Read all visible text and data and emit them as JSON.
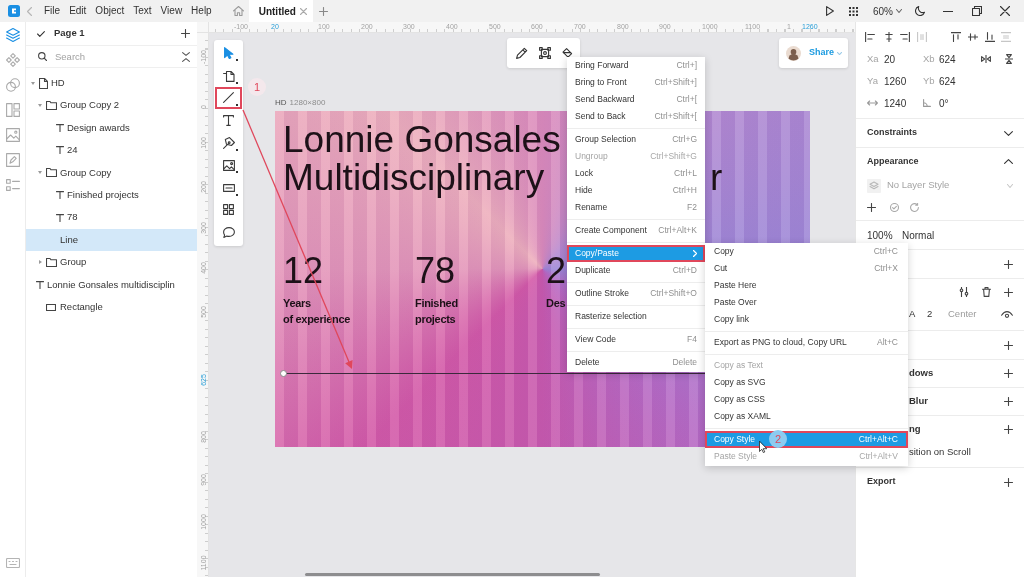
{
  "title_bar": {
    "menus": [
      {
        "label": "File"
      },
      {
        "label": "Edit"
      },
      {
        "label": "Object"
      },
      {
        "label": "Text"
      },
      {
        "label": "View"
      },
      {
        "label": "Help"
      }
    ],
    "tabs": [
      {
        "label": "Untitled",
        "selected": true
      }
    ],
    "zoom": "60%"
  },
  "sidebar_tabs": [
    {
      "selected": true
    },
    {
      "selected": false
    },
    {
      "selected": false
    },
    {
      "selected": false
    },
    {
      "selected": false
    },
    {
      "selected": false
    },
    {
      "selected": false
    }
  ],
  "layers_panel": {
    "page": "Page 1",
    "search": {
      "placeholder": "Search"
    },
    "tree": [
      {
        "label": "HD",
        "kind": "artboard",
        "expanded": true,
        "selected": false,
        "children": [
          {
            "label": "Group Copy 2",
            "kind": "group",
            "expanded": true,
            "selected": false,
            "children": [
              {
                "label": "Design awards",
                "kind": "text",
                "selected": false
              },
              {
                "label": "24",
                "kind": "text",
                "selected": false
              }
            ]
          },
          {
            "label": "Group Copy",
            "kind": "group",
            "expanded": true,
            "selected": false,
            "children": [
              {
                "label": "Finished projects",
                "kind": "text",
                "selected": false
              },
              {
                "label": "78",
                "kind": "text",
                "selected": false
              },
              {
                "label": "Line",
                "kind": "line",
                "selected": true
              }
            ]
          },
          {
            "label": "Group",
            "kind": "group",
            "expanded": false,
            "selected": false
          },
          {
            "label": "Lonnie Gonsales multidisciplin",
            "kind": "text",
            "selected": false
          },
          {
            "label": "Rectangle",
            "kind": "rectangle",
            "selected": false
          }
        ]
      }
    ]
  },
  "rulers": {
    "horizontal": [
      {
        "label": "-100",
        "highlighted": false
      },
      {
        "label": "20",
        "highlighted": true
      },
      {
        "label": "100",
        "highlighted": false
      },
      {
        "label": "200",
        "highlighted": false
      },
      {
        "label": "300",
        "highlighted": false
      },
      {
        "label": "400",
        "highlighted": false
      },
      {
        "label": "500",
        "highlighted": false
      },
      {
        "label": "600",
        "highlighted": false
      },
      {
        "label": "700",
        "highlighted": false
      },
      {
        "label": "800",
        "highlighted": false
      },
      {
        "label": "900",
        "highlighted": false
      },
      {
        "label": "1000",
        "highlighted": false
      },
      {
        "label": "1100",
        "highlighted": false
      },
      {
        "label": "1",
        "highlighted": false
      },
      {
        "label": "1260",
        "highlighted": true
      }
    ],
    "vertical": [
      {
        "label": "-100",
        "highlighted": false
      },
      {
        "label": "0",
        "highlighted": false
      },
      {
        "label": "100",
        "highlighted": false
      },
      {
        "label": "200",
        "highlighted": false
      },
      {
        "label": "300",
        "highlighted": false
      },
      {
        "label": "400",
        "highlighted": false
      },
      {
        "label": "500",
        "highlighted": false
      },
      {
        "label": "625",
        "highlighted": true
      },
      {
        "label": "800",
        "highlighted": false
      },
      {
        "label": "900",
        "highlighted": false
      },
      {
        "label": "1000",
        "highlighted": false
      },
      {
        "label": "1100",
        "highlighted": false
      }
    ]
  },
  "tools": [
    {
      "selected": true,
      "outlined": false,
      "has_options": true
    },
    {
      "selected": false,
      "outlined": false,
      "has_options": true
    },
    {
      "selected": false,
      "outlined": true,
      "has_options": true
    },
    {
      "selected": false,
      "outlined": false,
      "has_options": false
    },
    {
      "selected": false,
      "outlined": false,
      "has_options": true
    },
    {
      "selected": false,
      "outlined": false,
      "has_options": true
    },
    {
      "selected": false,
      "outlined": false,
      "has_options": true
    },
    {
      "selected": false,
      "outlined": false,
      "has_options": false
    },
    {
      "selected": false,
      "outlined": false,
      "has_options": false
    }
  ],
  "share": {
    "label": "Share"
  },
  "artboard": {
    "name": "HD",
    "size": "1280×800",
    "heading_lines": [
      "Lonnie Gonsales",
      "Multidisciplinary"
    ],
    "heading_fragment": "r",
    "stats": [
      {
        "value": "12",
        "label_lines": [
          "Years",
          "of experience"
        ]
      },
      {
        "value": "78",
        "label_lines": [
          "Finished",
          "projects"
        ]
      },
      {
        "value": "2",
        "label_lines": [
          "Des"
        ]
      }
    ]
  },
  "context_menu": {
    "sections": [
      {
        "items": [
          {
            "label": "Bring Forward",
            "shortcut": "Ctrl+]",
            "disabled": false,
            "selected": false,
            "outlined": false,
            "submenu": false
          },
          {
            "label": "Bring to Front",
            "shortcut": "Ctrl+Shift+]",
            "disabled": false,
            "selected": false,
            "outlined": false,
            "submenu": false
          },
          {
            "label": "Send Backward",
            "shortcut": "Ctrl+[",
            "disabled": false,
            "selected": false,
            "outlined": false,
            "submenu": false
          },
          {
            "label": "Send to Back",
            "shortcut": "Ctrl+Shift+[",
            "disabled": false,
            "selected": false,
            "outlined": false,
            "submenu": false
          }
        ]
      },
      {
        "items": [
          {
            "label": "Group Selection",
            "shortcut": "Ctrl+G",
            "disabled": false,
            "selected": false,
            "outlined": false,
            "submenu": false
          },
          {
            "label": "Ungroup",
            "shortcut": "Ctrl+Shift+G",
            "disabled": true,
            "selected": false,
            "outlined": false,
            "submenu": false
          },
          {
            "label": "Lock",
            "shortcut": "Ctrl+L",
            "disabled": false,
            "selected": false,
            "outlined": false,
            "submenu": false
          },
          {
            "label": "Hide",
            "shortcut": "Ctrl+H",
            "disabled": false,
            "selected": false,
            "outlined": false,
            "submenu": false
          },
          {
            "label": "Rename",
            "shortcut": "F2",
            "disabled": false,
            "selected": false,
            "outlined": false,
            "submenu": false
          }
        ]
      },
      {
        "items": [
          {
            "label": "Create Component",
            "shortcut": "Ctrl+Alt+K",
            "disabled": false,
            "selected": false,
            "outlined": false,
            "submenu": false
          }
        ]
      },
      {
        "items": [
          {
            "label": "Copy/Paste",
            "disabled": false,
            "selected": true,
            "outlined": true,
            "submenu": true
          },
          {
            "label": "Duplicate",
            "shortcut": "Ctrl+D",
            "disabled": false,
            "selected": false,
            "outlined": false,
            "submenu": false
          }
        ]
      },
      {
        "items": [
          {
            "label": "Outline Stroke",
            "shortcut": "Ctrl+Shift+O",
            "disabled": false,
            "selected": false,
            "outlined": false,
            "submenu": false
          }
        ]
      },
      {
        "items": [
          {
            "label": "Rasterize selection",
            "disabled": false,
            "selected": false,
            "outlined": false,
            "submenu": false
          }
        ]
      },
      {
        "items": [
          {
            "label": "View Code",
            "shortcut": "F4",
            "disabled": false,
            "selected": false,
            "outlined": false,
            "submenu": false
          }
        ]
      },
      {
        "items": [
          {
            "label": "Delete",
            "shortcut": "Delete",
            "disabled": false,
            "selected": false,
            "outlined": false,
            "submenu": false
          }
        ]
      }
    ]
  },
  "submenu": {
    "sections": [
      {
        "items": [
          {
            "label": "Copy",
            "shortcut": "Ctrl+C",
            "disabled": false,
            "selected": false,
            "outlined": false,
            "submenu": false
          },
          {
            "label": "Cut",
            "shortcut": "Ctrl+X",
            "disabled": false,
            "selected": false,
            "outlined": false,
            "submenu": false
          },
          {
            "label": "Paste Here",
            "disabled": false,
            "selected": false,
            "outlined": false,
            "submenu": false
          },
          {
            "label": "Paste Over",
            "disabled": false,
            "selected": false,
            "outlined": false,
            "submenu": false
          },
          {
            "label": "Copy link",
            "disabled": false,
            "selected": false,
            "outlined": false,
            "submenu": false
          }
        ]
      },
      {
        "items": [
          {
            "label": "Export as PNG to cloud, Copy URL",
            "shortcut": "Alt+C",
            "disabled": false,
            "selected": false,
            "outlined": false,
            "submenu": false
          }
        ]
      },
      {
        "items": [
          {
            "label": "Copy as Text",
            "disabled": true,
            "selected": false,
            "outlined": false,
            "submenu": false
          },
          {
            "label": "Copy as SVG",
            "disabled": false,
            "selected": false,
            "outlined": false,
            "submenu": false
          },
          {
            "label": "Copy as CSS",
            "disabled": false,
            "selected": false,
            "outlined": false,
            "submenu": false
          },
          {
            "label": "Copy as XAML",
            "disabled": false,
            "selected": false,
            "outlined": false,
            "submenu": false
          }
        ]
      },
      {
        "items": [
          {
            "label": "Copy Style",
            "shortcut": "Ctrl+Alt+C",
            "disabled": false,
            "selected": true,
            "outlined": true,
            "submenu": false
          },
          {
            "label": "Paste Style",
            "shortcut": "Ctrl+Alt+V",
            "disabled": true,
            "selected": false,
            "outlined": false,
            "submenu": false
          }
        ]
      }
    ]
  },
  "step_markers": [
    {
      "label": "1"
    },
    {
      "label": "2"
    }
  ],
  "inspector": {
    "geometry_rows": [
      {
        "cells": [
          {
            "label": "Xa",
            "value": "20"
          },
          {
            "label": "Xb",
            "value": "624"
          }
        ]
      },
      {
        "cells": [
          {
            "label": "Ya",
            "value": "1260"
          },
          {
            "label": "Yb",
            "value": "624"
          }
        ]
      },
      {
        "cells": [
          {
            "value": "1240"
          },
          {
            "value": "0°"
          }
        ]
      }
    ],
    "sections": [
      {
        "kind": "collapsible",
        "title": "Constraints",
        "expanded": false
      },
      {
        "kind": "appearance",
        "title": "Appearance",
        "expanded": true,
        "layer_style": {
          "value": "No Layer Style",
          "disabled": true
        }
      },
      {
        "kind": "blend",
        "opacity": "100%",
        "mode": "Normal"
      },
      {
        "kind": "add"
      },
      {
        "kind": "stroke",
        "fields": [
          {
            "value": "A",
            "disabled": false
          },
          {
            "value": "2",
            "disabled": false
          },
          {
            "value": "Center",
            "disabled": true
          }
        ]
      },
      {
        "kind": "add"
      },
      {
        "kind": "add_clipped",
        "title": "dows"
      },
      {
        "kind": "add_clipped",
        "title": "Blur"
      },
      {
        "kind": "add_clipped",
        "title": "ng",
        "detail": "sition on Scroll"
      },
      {
        "kind": "add",
        "title": "Export"
      }
    ]
  }
}
